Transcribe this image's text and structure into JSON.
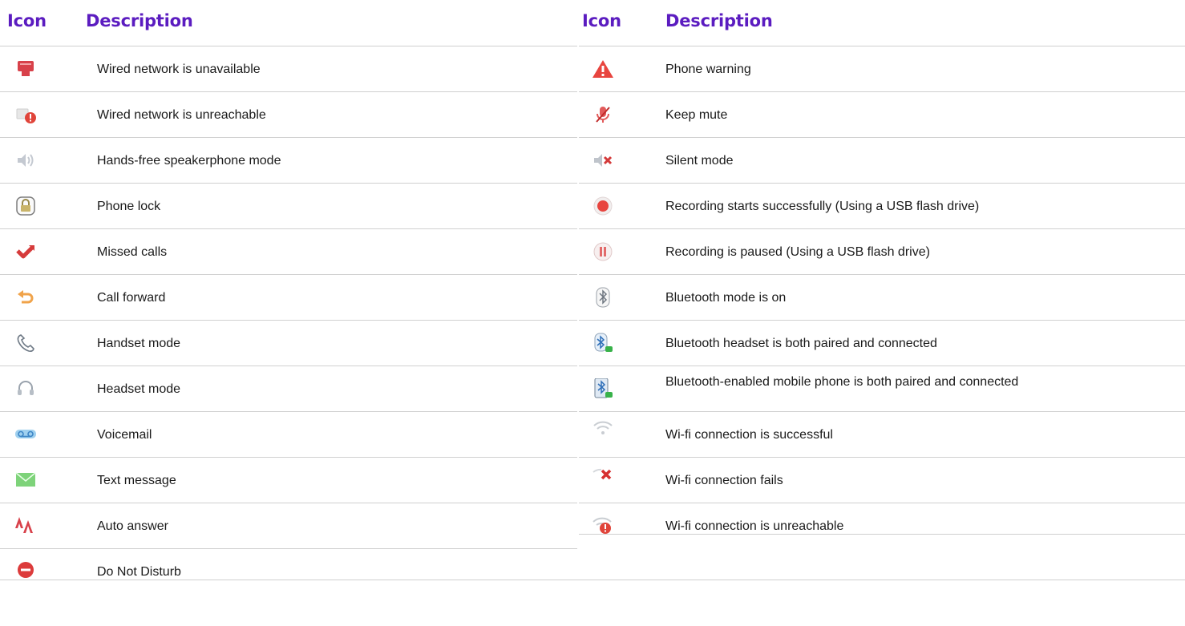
{
  "headers": {
    "left": {
      "icon": "Icon",
      "description": "Description"
    },
    "right": {
      "icon": "Icon",
      "description": "Description"
    }
  },
  "left_rows": [
    {
      "icon": "wired-network-unavailable-icon",
      "text": "Wired network is unavailable"
    },
    {
      "icon": "wired-network-unreachable-icon",
      "text": "Wired network is unreachable"
    },
    {
      "icon": "speakerphone-icon",
      "text": "Hands-free speakerphone mode"
    },
    {
      "icon": "phone-lock-icon",
      "text": "Phone lock"
    },
    {
      "icon": "missed-calls-icon",
      "text": "Missed calls"
    },
    {
      "icon": "call-forward-icon",
      "text": "Call forward"
    },
    {
      "icon": "handset-icon",
      "text": "Handset mode"
    },
    {
      "icon": "headset-icon",
      "text": "Headset mode"
    },
    {
      "icon": "voicemail-icon",
      "text": "Voicemail"
    },
    {
      "icon": "text-message-icon",
      "text": "Text message"
    },
    {
      "icon": "auto-answer-icon",
      "text": "Auto answer"
    },
    {
      "icon": "do-not-disturb-icon",
      "text": "Do Not Disturb"
    }
  ],
  "right_rows": [
    {
      "icon": "phone-warning-icon",
      "text": "Phone warning"
    },
    {
      "icon": "keep-mute-icon",
      "text": "Keep mute"
    },
    {
      "icon": "silent-mode-icon",
      "text": "Silent mode"
    },
    {
      "icon": "recording-start-icon",
      "text": "Recording starts successfully (Using a USB flash drive)"
    },
    {
      "icon": "recording-paused-icon",
      "text": "Recording is paused (Using a USB flash drive)"
    },
    {
      "icon": "bluetooth-on-icon",
      "text": "Bluetooth mode is on"
    },
    {
      "icon": "bluetooth-headset-icon",
      "text": "Bluetooth headset is both paired and connected"
    },
    {
      "icon": "bluetooth-mobile-icon",
      "text": "Bluetooth-enabled mobile phone is both paired and connected"
    },
    {
      "icon": "wifi-success-icon",
      "text": "Wi-fi connection is successful"
    },
    {
      "icon": "wifi-fail-icon",
      "text": "Wi-fi connection fails"
    },
    {
      "icon": "wifi-unreachable-icon",
      "text": "Wi-fi connection is unreachable"
    }
  ],
  "colors": {
    "header": "#5b1cc0",
    "rule": "#d0d0d0",
    "red": "#e0443a"
  }
}
